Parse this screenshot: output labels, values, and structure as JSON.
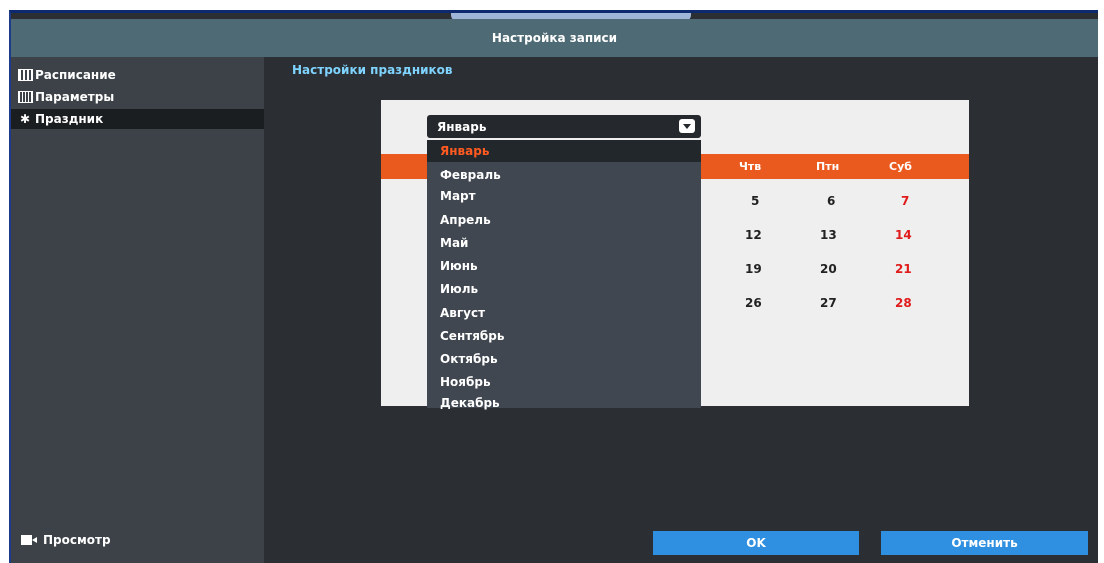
{
  "window": {
    "title": "Настройка записи"
  },
  "sidebar": {
    "items": [
      {
        "label": "Расписание",
        "icon": "calendar-icon"
      },
      {
        "label": "Параметры",
        "icon": "parameters-icon"
      },
      {
        "label": "Праздник",
        "icon": "palm-tree-icon",
        "active": true
      }
    ],
    "preview": {
      "label": "Просмотр",
      "icon": "camera-icon"
    }
  },
  "content": {
    "title": "Настройки праздников"
  },
  "month_select": {
    "value": "Январь",
    "options": [
      "Январь",
      "Февраль",
      "Март",
      "Апрель",
      "Май",
      "Июнь",
      "Июль",
      "Август",
      "Сентябрь",
      "Октябрь",
      "Ноябрь",
      "Декабрь"
    ]
  },
  "calendar": {
    "headers": [
      "Чтв",
      "Птн",
      "Суб"
    ],
    "rows": [
      [
        "5",
        "6",
        "7"
      ],
      [
        "12",
        "13",
        "14"
      ],
      [
        "19",
        "20",
        "21"
      ],
      [
        "26",
        "27",
        "28"
      ]
    ],
    "weekend_color": "#e01b1b",
    "header_color": "#ea5a1f"
  },
  "buttons": {
    "ok": "OK",
    "cancel": "Отменить"
  },
  "colors": {
    "accent": "#2f8fe0",
    "selected_text": "#ff5a1f",
    "title_text": "#7fd3ff"
  }
}
